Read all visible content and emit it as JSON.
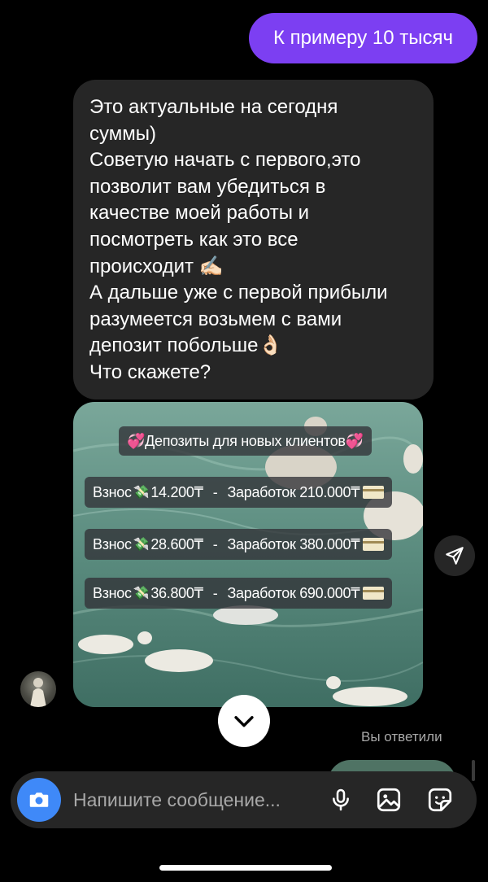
{
  "chat": {
    "sent_message": "К примеру 10 тысяч",
    "received_lines": [
      "Это актуальные на сегодня",
      "суммы)",
      "Советую начать с первого,это",
      "позволит вам убедиться в",
      "качестве моей работы и",
      "посмотреть как это все",
      "происходит ✍🏻",
      "А дальше уже с первой прибыли",
      "разумеется возьмем с вами",
      "депозит побольше👌🏻",
      "Что скажете?"
    ],
    "replied_label": "Вы ответили"
  },
  "promo": {
    "title": "💞Депозиты для новых клиентов💞",
    "rows": [
      {
        "deposit": "Взнос",
        "amount": "14.200₸",
        "sep": "-",
        "earning": "Заработок 210.000₸"
      },
      {
        "deposit": "Взнос",
        "amount": "28.600₸",
        "sep": "-",
        "earning": "Заработок 380.000₸"
      },
      {
        "deposit": "Взнос",
        "amount": "36.800₸",
        "sep": "-",
        "earning": "Заработок 690.000₸"
      }
    ]
  },
  "composer": {
    "placeholder": "Напишите сообщение..."
  },
  "icons": {
    "camera": "camera-icon",
    "mic": "microphone-icon",
    "gallery": "gallery-icon",
    "sticker": "sticker-icon",
    "share": "paper-plane-icon",
    "scroll_down": "chevron-down-icon"
  },
  "colors": {
    "sent_bubble": "#7c3ff2",
    "received_bubble": "#262626",
    "camera_button": "#3f89f8"
  }
}
